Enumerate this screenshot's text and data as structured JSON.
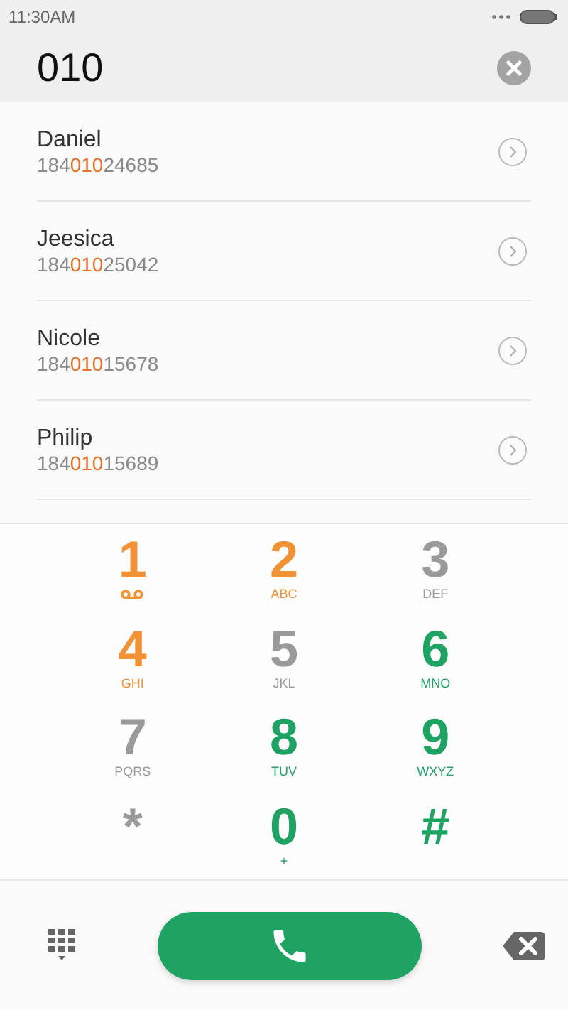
{
  "status_bar": {
    "time": "11:30AM"
  },
  "search": {
    "value": "010"
  },
  "contacts": [
    {
      "name": "Daniel",
      "number": [
        {
          "text": "184",
          "highlighted": false
        },
        {
          "text": "010",
          "highlighted": true
        },
        {
          "text": "24685",
          "highlighted": false
        }
      ]
    },
    {
      "name": "Jeesica",
      "number": [
        {
          "text": "184",
          "highlighted": false
        },
        {
          "text": "010",
          "highlighted": true
        },
        {
          "text": "25042",
          "highlighted": false
        }
      ]
    },
    {
      "name": "Nicole",
      "number": [
        {
          "text": "184",
          "highlighted": false
        },
        {
          "text": "010",
          "highlighted": true
        },
        {
          "text": "15678",
          "highlighted": false
        }
      ]
    },
    {
      "name": "Philip",
      "number": [
        {
          "text": "184",
          "highlighted": false
        },
        {
          "text": "010",
          "highlighted": true
        },
        {
          "text": "15689",
          "highlighted": false
        }
      ]
    }
  ],
  "keypad": [
    {
      "digit": "1",
      "kind": "voicemail",
      "color": "#f39235"
    },
    {
      "digit": "2",
      "kind": "letters",
      "letters": "ABC",
      "color": "#f39235"
    },
    {
      "digit": "3",
      "kind": "letters",
      "letters": "DEF",
      "color": "#9a9a9a"
    },
    {
      "digit": "4",
      "kind": "letters",
      "letters": "GHI",
      "color": "#f39235"
    },
    {
      "digit": "5",
      "kind": "letters",
      "letters": "JKL",
      "color": "#9a9a9a"
    },
    {
      "digit": "6",
      "kind": "letters",
      "letters": "MNO",
      "color": "#1ea363"
    },
    {
      "digit": "7",
      "kind": "letters",
      "letters": "PQRS",
      "color": "#9a9a9a"
    },
    {
      "digit": "8",
      "kind": "letters",
      "letters": "TUV",
      "color": "#1ea363"
    },
    {
      "digit": "9",
      "kind": "letters",
      "letters": "WXYZ",
      "color": "#1ea363"
    },
    {
      "digit": "*",
      "kind": "plain",
      "color": "#9a9a9a"
    },
    {
      "digit": "0",
      "kind": "letters",
      "letters": "+",
      "color": "#1ea363"
    },
    {
      "digit": "#",
      "kind": "plain",
      "color": "#1ea363"
    }
  ]
}
